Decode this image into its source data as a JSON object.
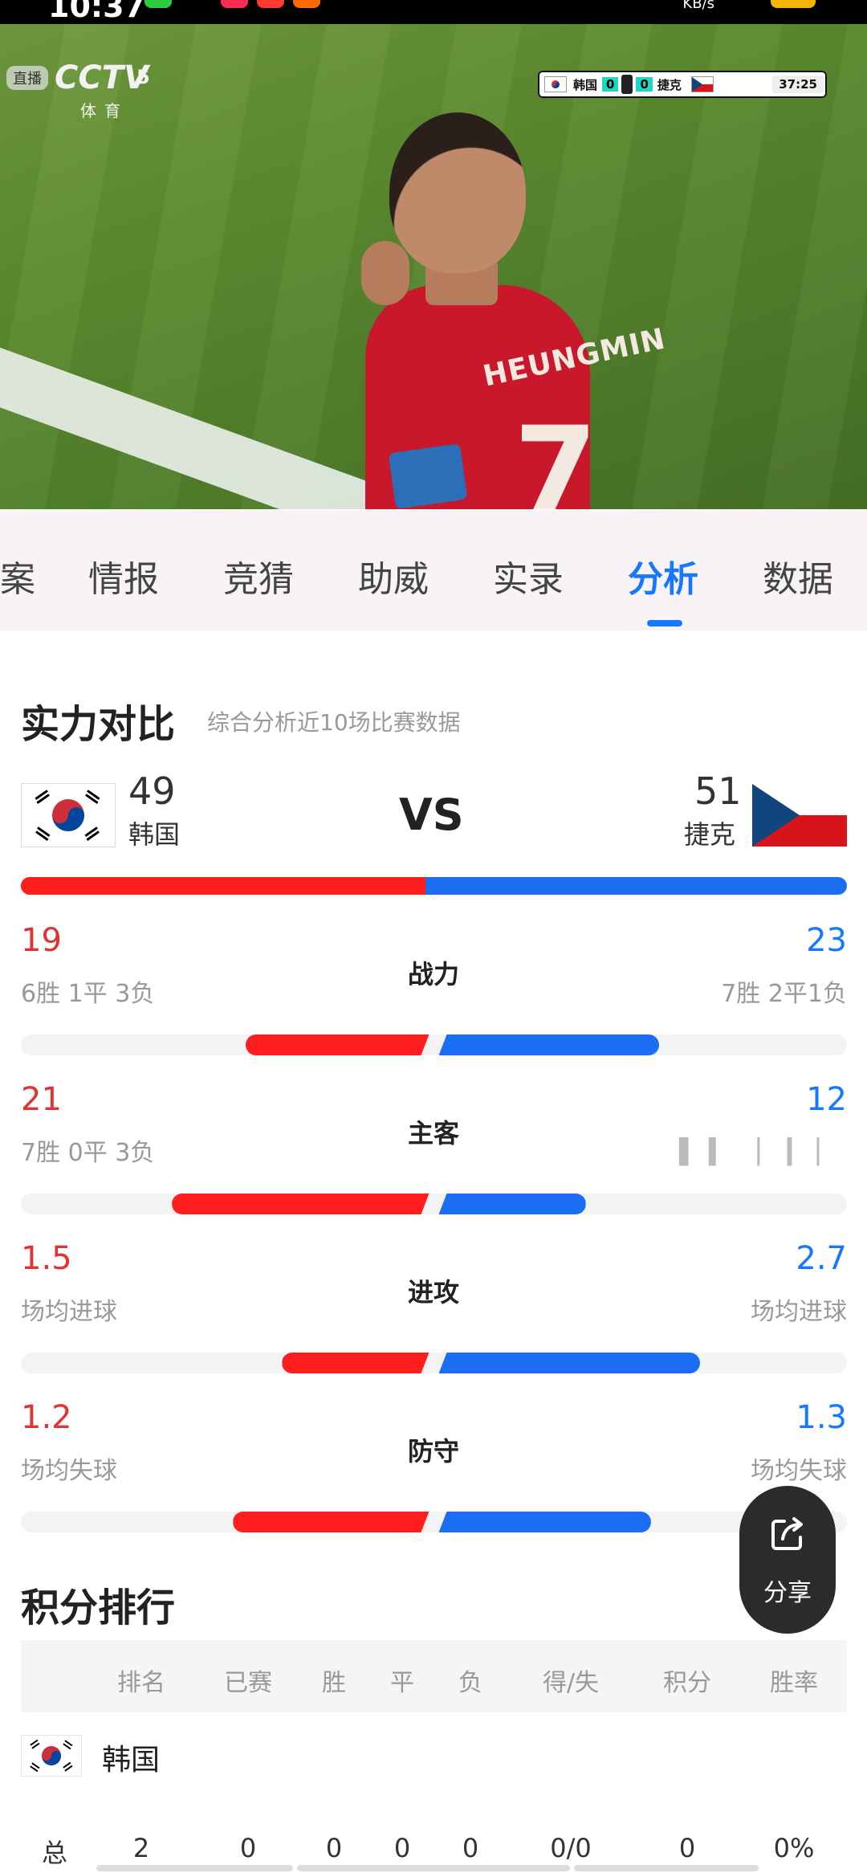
{
  "status_bar": {
    "time": "10:37",
    "speed": "KB/s"
  },
  "video": {
    "live_badge": "直播",
    "channel": "CCTV",
    "channel_number": "5",
    "channel_sub": "体育",
    "player_name": "HEUNGMIN",
    "player_number": "7",
    "scoreboard": {
      "home": "韩国",
      "home_score": "0",
      "away_score": "0",
      "away": "捷克",
      "clock": "37:25"
    }
  },
  "tabs": [
    {
      "label": "案"
    },
    {
      "label": "情报"
    },
    {
      "label": "竞猜"
    },
    {
      "label": "助威"
    },
    {
      "label": "实录"
    },
    {
      "label": "分析",
      "active": true
    },
    {
      "label": "数据"
    }
  ],
  "strength": {
    "title": "实力对比",
    "subtitle": "综合分析近10场比赛数据",
    "home": {
      "name": "韩国",
      "score": "49"
    },
    "away": {
      "name": "捷克",
      "score": "51"
    },
    "vs": "VS",
    "home_share": 0.49,
    "stats": [
      {
        "name": "战力",
        "left_value": "19",
        "left_sub": "6胜 1平 3负",
        "right_value": "23",
        "right_sub": "7胜 2平1负",
        "left_frac": 0.45,
        "right_frac": 0.54
      },
      {
        "name": "主客",
        "left_value": "21",
        "left_sub": "7胜 0平 3负",
        "right_value": "12",
        "right_sub": "",
        "left_frac": 0.63,
        "right_frac": 0.36
      },
      {
        "name": "进攻",
        "left_value": "1.5",
        "left_sub": "场均进球",
        "right_value": "2.7",
        "right_sub": "场均进球",
        "left_frac": 0.36,
        "right_frac": 0.64
      },
      {
        "name": "防守",
        "left_value": "1.2",
        "left_sub": "场均失球",
        "right_value": "1.3",
        "right_sub": "场均失球",
        "left_frac": 0.48,
        "right_frac": 0.52
      }
    ]
  },
  "share": {
    "label": "分享"
  },
  "standings": {
    "title": "积分排行",
    "headers": [
      "排名",
      "已赛",
      "胜",
      "平",
      "负",
      "得/失",
      "积分",
      "胜率"
    ],
    "team": "韩国",
    "row": {
      "label": "总",
      "values": [
        "2",
        "0",
        "0",
        "0",
        "0",
        "0/0",
        "0",
        "0%"
      ]
    }
  },
  "colors": {
    "accent": "#1677ff",
    "home": "#ff1e1e",
    "away": "#1b6ef3"
  }
}
